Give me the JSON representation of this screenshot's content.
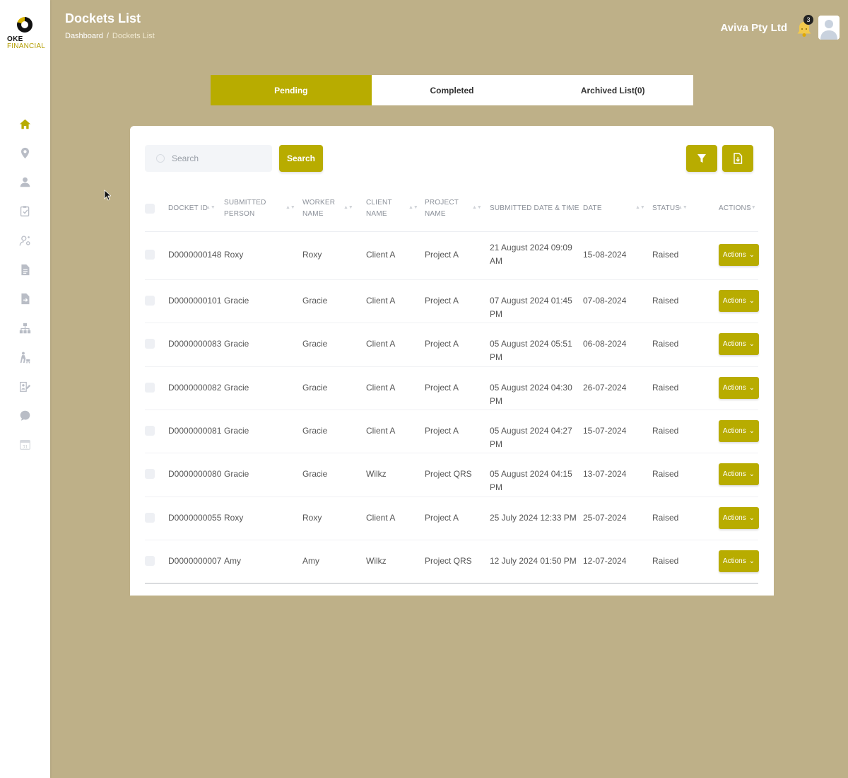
{
  "brand": {
    "line1": "OKE",
    "line2": "FINANCIAL"
  },
  "header": {
    "title": "Dockets List",
    "breadcrumb": [
      "Dashboard",
      "Dockets List"
    ],
    "company": "Aviva Pty Ltd",
    "notification_count": "3"
  },
  "sidebar_icons": [
    "home-icon",
    "location-icon",
    "user-icon",
    "clipboard-check-icon",
    "user-settings-icon",
    "document-icon",
    "document-export-icon",
    "sitemap-icon",
    "worker-icon",
    "user-edit-icon",
    "chat-icon",
    "calendar-icon"
  ],
  "calendar_day": "31",
  "tabs": [
    {
      "label": "Pending",
      "active": true
    },
    {
      "label": "Completed",
      "active": false
    },
    {
      "label": "Archived List(0)",
      "active": false
    }
  ],
  "search": {
    "placeholder": "Search",
    "button": "Search"
  },
  "table": {
    "headers": {
      "docket_id": "DOCKET ID",
      "submitted_person_1": "SUBMITTED",
      "submitted_person_2": "PERSON",
      "worker_name_1": "WORKER",
      "worker_name_2": "NAME",
      "client_name_1": "CLIENT",
      "client_name_2": "NAME",
      "project_name_1": "PROJECT",
      "project_name_2": "NAME",
      "submitted_dt": "SUBMITTED DATE & TIME",
      "date": "DATE",
      "status": "STATUS",
      "actions": "ACTIONS"
    },
    "rows": [
      {
        "id": "D0000000148",
        "person": "Roxy",
        "worker": "Roxy",
        "client": "Client A",
        "project": "Project A",
        "submitted_1": "21 August 2024 09:09",
        "submitted_2": "AM",
        "date": "15-08-2024",
        "status": "Raised",
        "action": "Actions"
      },
      {
        "id": "D0000000101",
        "person": "Gracie",
        "worker": "Gracie",
        "client": "Client A",
        "project": "Project A",
        "submitted_1": "07 August 2024 01:45 PM",
        "submitted_2": "",
        "date": "07-08-2024",
        "status": "Raised",
        "action": "Actions"
      },
      {
        "id": "D0000000083",
        "person": "Gracie",
        "worker": "Gracie",
        "client": "Client A",
        "project": "Project A",
        "submitted_1": "05 August 2024 05:51 PM",
        "submitted_2": "",
        "date": "06-08-2024",
        "status": "Raised",
        "action": "Actions"
      },
      {
        "id": "D0000000082",
        "person": "Gracie",
        "worker": "Gracie",
        "client": "Client A",
        "project": "Project A",
        "submitted_1": "05 August 2024 04:30 PM",
        "submitted_2": "",
        "date": "26-07-2024",
        "status": "Raised",
        "action": "Actions"
      },
      {
        "id": "D0000000081",
        "person": "Gracie",
        "worker": "Gracie",
        "client": "Client A",
        "project": "Project A",
        "submitted_1": "05 August 2024 04:27 PM",
        "submitted_2": "",
        "date": "15-07-2024",
        "status": "Raised",
        "action": "Actions"
      },
      {
        "id": "D0000000080",
        "person": "Gracie",
        "worker": "Gracie",
        "client": "Wilkz",
        "project": "Project QRS",
        "submitted_1": "05 August 2024 04:15 PM",
        "submitted_2": "",
        "date": "13-07-2024",
        "status": "Raised",
        "action": "Actions"
      },
      {
        "id": "D0000000055",
        "person": "Roxy",
        "worker": "Roxy",
        "client": "Client A",
        "project": "Project A",
        "submitted_1": "25 July 2024 12:33 PM",
        "submitted_2": "",
        "date": "25-07-2024",
        "status": "Raised",
        "action": "Actions"
      },
      {
        "id": "D0000000007",
        "person": "Amy",
        "worker": "Amy",
        "client": "Wilkz",
        "project": "Project QRS",
        "submitted_1": "12 July 2024 01:50 PM",
        "submitted_2": "",
        "date": "12-07-2024",
        "status": "Raised",
        "action": "Actions"
      }
    ]
  },
  "colors": {
    "accent": "#b8ac00",
    "background": "#beb088",
    "sidebar_active": "#b8ac00",
    "sidebar_icon": "#b9bdc6"
  }
}
